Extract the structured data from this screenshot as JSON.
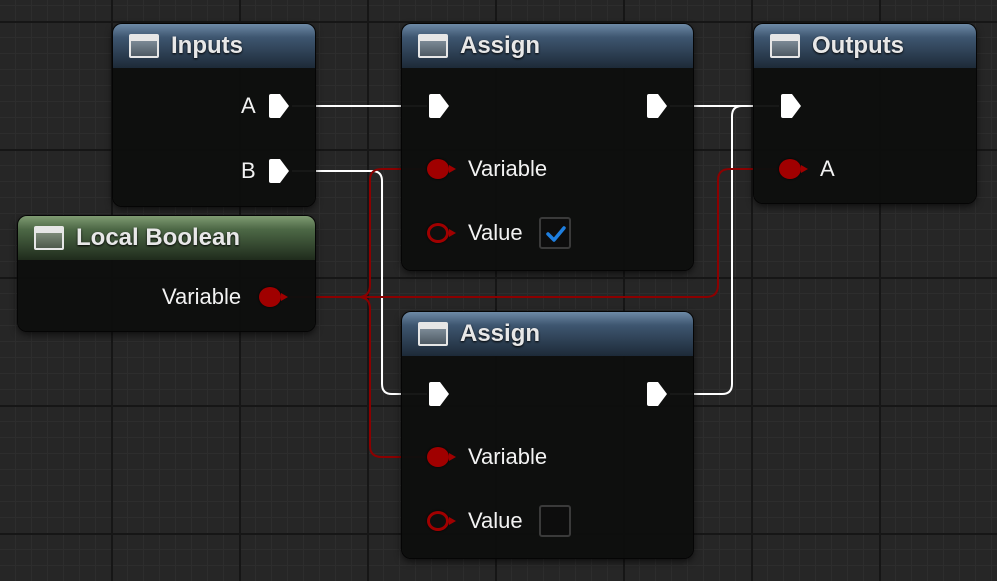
{
  "nodes": {
    "inputs": {
      "title": "Inputs",
      "pins": {
        "a": "A",
        "b": "B"
      }
    },
    "local_boolean": {
      "title": "Local Boolean",
      "pins": {
        "variable": "Variable"
      }
    },
    "assign_top": {
      "title": "Assign",
      "pins": {
        "variable": "Variable",
        "value": "Value"
      },
      "value_checked": true
    },
    "assign_bottom": {
      "title": "Assign",
      "pins": {
        "variable": "Variable",
        "value": "Value"
      },
      "value_checked": false
    },
    "outputs": {
      "title": "Outputs",
      "pins": {
        "a": "A"
      }
    }
  },
  "colors": {
    "exec_wire": "#ffffff",
    "bool_wire": "#8b0000",
    "bool_pin": "#a00000",
    "checkbox_check": "#1e7fe0",
    "blue_header": "#3e5670",
    "green_header": "#4d6846"
  },
  "icons": {
    "node_icon": "function-node-icon",
    "exec_pin": "exec-arrow-pin-icon",
    "data_pin": "boolean-pin-icon",
    "check": "checkmark-icon"
  }
}
